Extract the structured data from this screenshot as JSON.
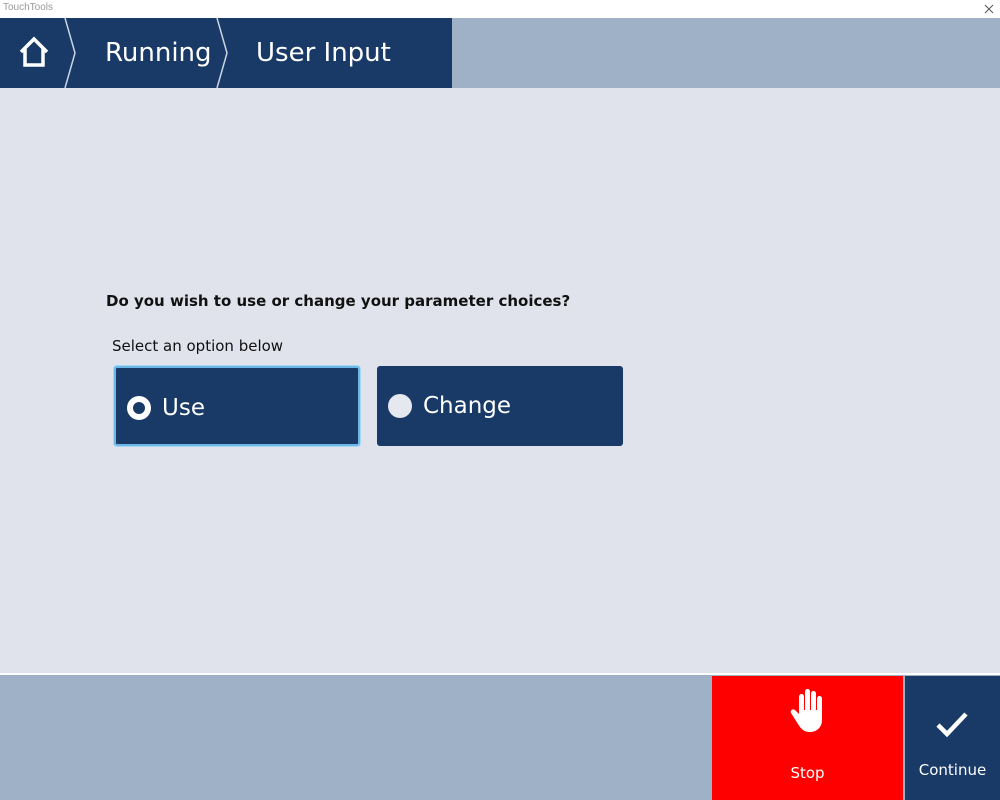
{
  "window": {
    "title": "TouchTools"
  },
  "breadcrumb": {
    "items": [
      {
        "label": "Running"
      },
      {
        "label": "User Input"
      }
    ]
  },
  "prompt": {
    "question": "Do you wish to use or change your parameter choices?",
    "hint": "Select an option below"
  },
  "options": [
    {
      "label": "Use",
      "selected": true
    },
    {
      "label": "Change",
      "selected": false
    }
  ],
  "footer": {
    "stop_label": "Stop",
    "continue_label": "Continue"
  },
  "colors": {
    "navy": "#193a67",
    "steel": "#9fb1c7",
    "background": "#e0e3ec",
    "stop_red": "#ff0000",
    "selection_outline": "#69b8e8"
  },
  "icons": {
    "home": "home-icon",
    "stop": "stop-hand-icon",
    "continue": "checkmark-icon",
    "close": "close-icon"
  }
}
